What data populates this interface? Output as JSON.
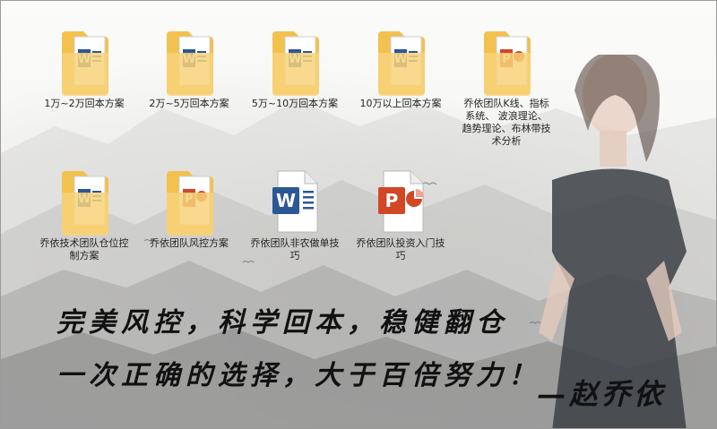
{
  "files": [
    {
      "label": "1万~2万回本方案",
      "icon": "word-folder-icon"
    },
    {
      "label": "2万~5万回本方案",
      "icon": "word-folder-icon"
    },
    {
      "label": "5万~10万回本方案",
      "icon": "word-folder-icon"
    },
    {
      "label": "10万以上回本方案",
      "icon": "word-folder-icon"
    },
    {
      "label": "乔依团队K线、指标系统、 波浪理论、 趋势理论、布林带技术分析",
      "icon": "ppt-folder-icon"
    },
    {
      "label": "乔依技术团队仓位控制方案",
      "icon": "word-folder-icon"
    },
    {
      "label": "乔依团队风控方案",
      "icon": "ppt-folder-icon"
    },
    {
      "label": "乔依团队非农做单技巧",
      "icon": "word-doc-icon"
    },
    {
      "label": "乔依团队投资入门技巧",
      "icon": "ppt-doc-icon"
    }
  ],
  "slogan": {
    "line1": "完美风控，科学回本，稳健翻仓",
    "line2": "一次正确的选择，大于百倍努力！",
    "signature": "—赵乔依"
  },
  "colors": {
    "folder": "#f2c14e",
    "word": "#2b5797",
    "ppt": "#d24726"
  }
}
